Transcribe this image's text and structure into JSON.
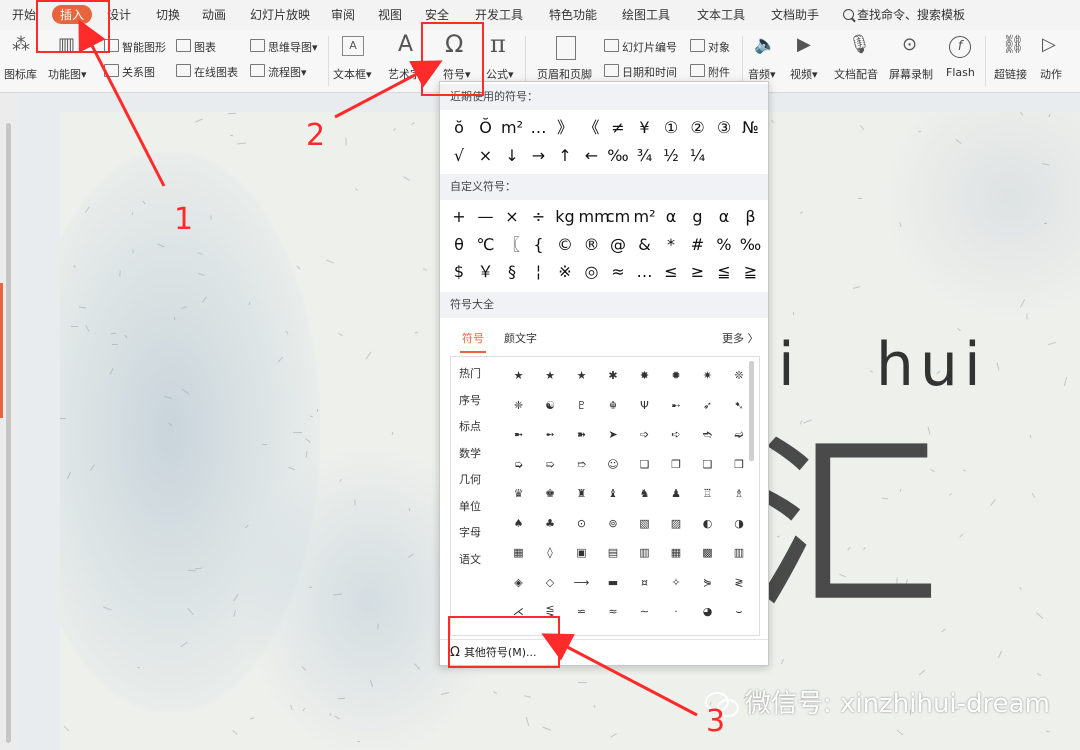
{
  "tabs": [
    "开始",
    "插入",
    "设计",
    "切换",
    "动画",
    "幻灯片放映",
    "审阅",
    "视图",
    "安全",
    "开发工具",
    "特色功能",
    "绘图工具",
    "文本工具",
    "文档助手"
  ],
  "active_tab": "插入",
  "search_label": "查找命令、搜索模板",
  "ribbon": {
    "icon_library": "图标库",
    "function_chart": "功能图",
    "smart_shape": "智能图形",
    "chart": "图表",
    "relation_chart": "关系图",
    "online_chart": "在线图表",
    "mind_map": "思维导图",
    "flowchart": "流程图",
    "textbox": "文本框",
    "art_text": "艺术字",
    "symbol": "符号",
    "formula": "公式",
    "header_footer": "页眉和页脚",
    "slide_number": "幻灯片编号",
    "object": "对象",
    "date_time": "日期和时间",
    "attachment": "附件",
    "audio": "音频",
    "video": "视频",
    "doc_voiceover": "文档配音",
    "screen_record": "屏幕录制",
    "flash": "Flash",
    "hyperlink": "超链接",
    "action": "动作"
  },
  "dropdown": {
    "recent_title": "近期使用的符号：",
    "recent_symbols": [
      "ŏ",
      "Ŏ",
      "m²",
      "…",
      "》",
      "《",
      "≠",
      "¥",
      "①",
      "②",
      "③",
      "№",
      "√",
      "×",
      "↓",
      "→",
      "↑",
      "←",
      "‰",
      "¾",
      "½",
      "¼"
    ],
    "custom_title": "自定义符号：",
    "custom_symbols": [
      "+",
      "—",
      "×",
      "÷",
      "kg",
      "mm",
      "cm",
      "m²",
      "α",
      "g",
      "α",
      "β",
      "θ",
      "℃",
      "〖",
      "{",
      "©",
      "®",
      "@",
      "&",
      "*",
      "#",
      "%",
      "‰",
      "$",
      "￥",
      "§",
      "¦",
      "※",
      "◎",
      "≈",
      "…",
      "≤",
      "≥",
      "≦",
      "≧"
    ],
    "library_title": "符号大全",
    "sub_tabs": [
      "符号",
      "颜文字"
    ],
    "more_link": "更多 〉",
    "categories": [
      "热门",
      "序号",
      "标点",
      "数学",
      "几何",
      "单位",
      "字母",
      "语文"
    ],
    "gallery_symbols": [
      "★",
      "★",
      "★",
      "✱",
      "✸",
      "✹",
      "✷",
      "❊",
      "❈",
      "☯",
      "♇",
      "☬",
      "Ψ",
      "➸",
      "➶",
      "➷",
      "➼",
      "➻",
      "➽",
      "➤",
      "➩",
      "➪",
      "➬",
      "➫",
      "➭",
      "➯",
      "➱",
      "☺",
      "❏",
      "❐",
      "❑",
      "❒",
      "♛",
      "♚",
      "♜",
      "♝",
      "♞",
      "♟",
      "♖",
      "♗",
      "♠",
      "♣",
      "⊙",
      "⊚",
      "▧",
      "▨",
      "◐",
      "◑",
      "▦",
      "◊",
      "▣",
      "▤",
      "▥",
      "▦",
      "▩",
      "▥",
      "◈",
      "◇",
      "⟶",
      "▬",
      "¤",
      "✧",
      "⋟",
      "≷",
      "⋌",
      "⋚",
      "⋍",
      "≈",
      "∼",
      "·",
      "◕",
      "⌣"
    ],
    "more_symbols_button": "其他符号(M)..."
  },
  "slide": {
    "pinyin": "i   hui",
    "title_fragment": "汇"
  },
  "watermark": "微信号: xinzhihui-dream",
  "annotations": [
    "1",
    "2",
    "3"
  ],
  "colors": {
    "accent": "#e8643c",
    "annotation_red": "#ff2a2a"
  }
}
